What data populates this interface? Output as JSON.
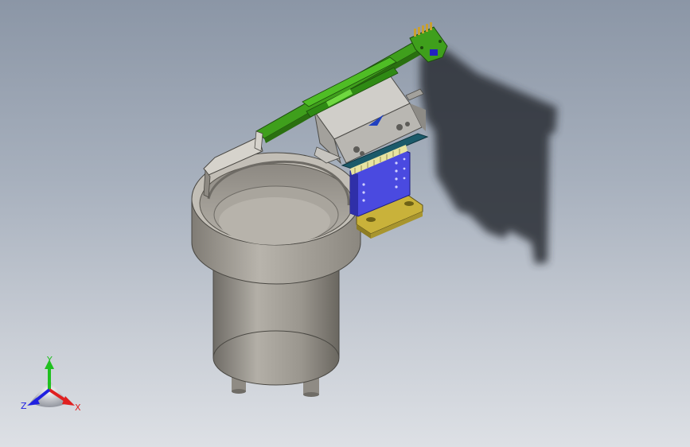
{
  "viewport": {
    "background_top": "#8b96a6",
    "background_bottom": "#dde0e5"
  },
  "model": {
    "name": "vibratory-bowl-feeder",
    "colors": {
      "bowl": "#a8a49c",
      "bowl_dark": "#7f7b74",
      "track": "#3f9f1c",
      "housing": "#b9b7b2",
      "blue_plate": "#4a4ae0",
      "base_plate": "#c9b23a",
      "shadow": "#2b2f36"
    }
  },
  "triad": {
    "x_label": "X",
    "y_label": "Y",
    "z_label": "Z",
    "x_color": "#e02020",
    "y_color": "#20c020",
    "z_color": "#2020e0"
  }
}
